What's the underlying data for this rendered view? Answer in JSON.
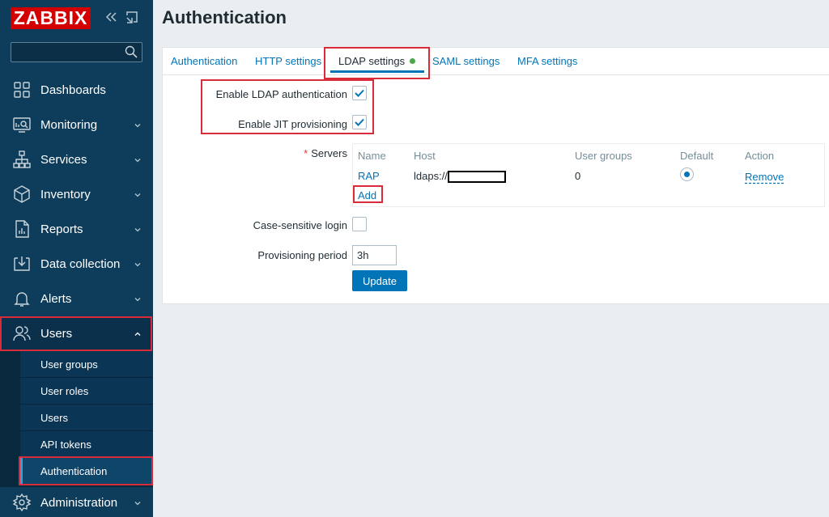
{
  "brand": {
    "logo_text": "ZABBIX",
    "logo_color": "#d40000"
  },
  "sidebar": {
    "collapse_icon": "double-chevron-left-icon",
    "kiosk_icon": "kiosk-mode-icon",
    "search": {
      "value": "",
      "placeholder": "",
      "icon": "search-icon"
    },
    "items": [
      {
        "label": "Dashboards",
        "icon": "dashboards-icon",
        "has_chevron": false
      },
      {
        "label": "Monitoring",
        "icon": "monitoring-icon",
        "has_chevron": true
      },
      {
        "label": "Services",
        "icon": "services-icon",
        "has_chevron": true
      },
      {
        "label": "Inventory",
        "icon": "inventory-icon",
        "has_chevron": true
      },
      {
        "label": "Reports",
        "icon": "reports-icon",
        "has_chevron": true
      },
      {
        "label": "Data collection",
        "icon": "data-collection-icon",
        "has_chevron": true
      },
      {
        "label": "Alerts",
        "icon": "alerts-icon",
        "has_chevron": true
      },
      {
        "label": "Users",
        "icon": "users-icon",
        "has_chevron": true,
        "expanded": true
      },
      {
        "label": "Administration",
        "icon": "administration-icon",
        "has_chevron": true
      }
    ],
    "users_submenu": [
      "User groups",
      "User roles",
      "Users",
      "API tokens",
      "Authentication"
    ],
    "active_submenu": "Authentication"
  },
  "page": {
    "title": "Authentication"
  },
  "tabs": [
    {
      "label": "Authentication",
      "active": false
    },
    {
      "label": "HTTP settings",
      "active": false
    },
    {
      "label": "LDAP settings",
      "active": true,
      "status_dot_color": "#4ca64c"
    },
    {
      "label": "SAML settings",
      "active": false
    },
    {
      "label": "MFA settings",
      "active": false
    }
  ],
  "form": {
    "enable_ldap": {
      "label": "Enable LDAP authentication",
      "checked": true
    },
    "enable_jit": {
      "label": "Enable JIT provisioning",
      "checked": true
    },
    "servers": {
      "required_mark": "*",
      "label": "Servers",
      "columns": [
        "Name",
        "Host",
        "User groups",
        "Default",
        "Action"
      ],
      "rows": [
        {
          "name": "RAP",
          "host": "ldaps://",
          "user_groups": "0",
          "default": true,
          "action": "Remove"
        }
      ],
      "add_label": "Add"
    },
    "case_sensitive": {
      "label": "Case-sensitive login",
      "checked": false
    },
    "provisioning_period": {
      "label": "Provisioning period",
      "value": "3h"
    },
    "update_label": "Update"
  },
  "colors": {
    "accent": "#0275b8",
    "sidebar_bg": "#0e3d5c",
    "highlight_box": "#d92b3a"
  }
}
